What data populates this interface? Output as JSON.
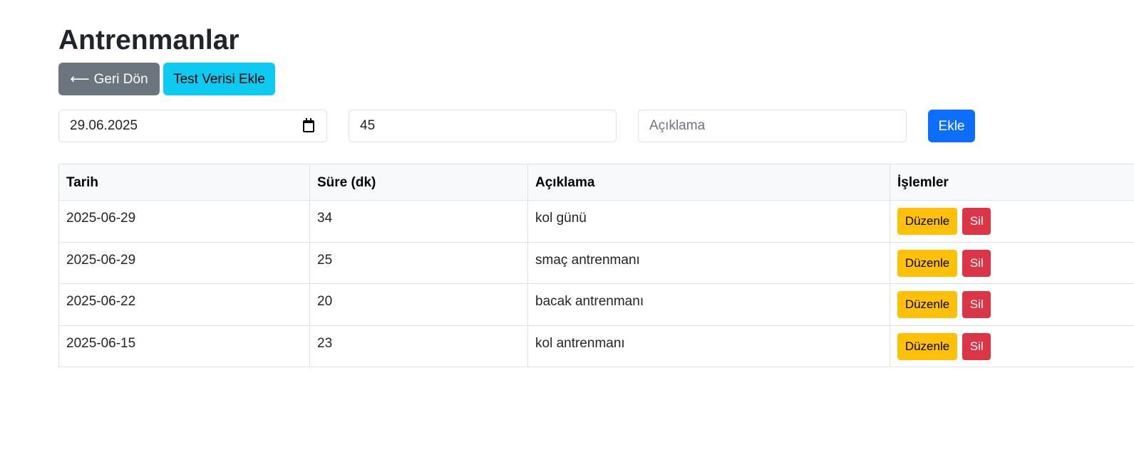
{
  "page": {
    "title": "Antrenmanlar"
  },
  "toolbar": {
    "back_arrow": "⟵",
    "back_label": "Geri Dön",
    "test_data_label": "Test Verisi Ekle"
  },
  "form": {
    "date_value": "29.06.2025",
    "duration_value": "45",
    "description_placeholder": "Açıklama",
    "add_label": "Ekle"
  },
  "table": {
    "headers": {
      "date": "Tarih",
      "duration": "Süre (dk)",
      "description": "Açıklama",
      "actions": "İşlemler"
    },
    "rows": [
      {
        "date": "2025-06-29",
        "duration": "34",
        "description": "kol günü",
        "edit_label": "Düzenle",
        "delete_label": "Sil"
      },
      {
        "date": "2025-06-29",
        "duration": "25",
        "description": "smaç antrenmanı",
        "edit_label": "Düzenle",
        "delete_label": "Sil"
      },
      {
        "date": "2025-06-22",
        "duration": "20",
        "description": "bacak antrenmanı",
        "edit_label": "Düzenle",
        "delete_label": "Sil"
      },
      {
        "date": "2025-06-15",
        "duration": "23",
        "description": "kol antrenmanı",
        "edit_label": "Düzenle",
        "delete_label": "Sil"
      }
    ]
  },
  "icons": {
    "date_picker": "calendar-icon"
  },
  "colors": {
    "back_button": "#6c757d",
    "test_button": "#0dcaf0",
    "add_button": "#0d6efd",
    "edit_button": "#ffc107",
    "delete_button": "#dc3545",
    "table_header_bg": "#f8f9fa",
    "border": "#dee2e6"
  }
}
